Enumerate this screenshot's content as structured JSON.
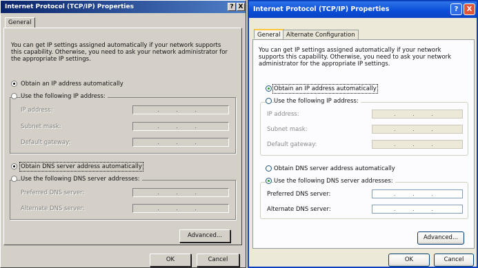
{
  "left": {
    "title": "Internet Protocol (TCP/IP) Properties",
    "help_btn": "?",
    "close_btn": "X",
    "tabs": [
      "General"
    ],
    "description": "You can get IP settings assigned automatically if your network supports this capability. Otherwise, you need to ask your network administrator for the appropriate IP settings.",
    "radio_auto_ip": "Obtain an IP address automatically",
    "radio_manual_ip": "Use the following IP address:",
    "ip_address_label": "IP address:",
    "subnet_label": "Subnet mask:",
    "gateway_label": "Default gateway:",
    "radio_auto_dns": "Obtain DNS server address automatically",
    "radio_manual_dns": "Use the following DNS server addresses:",
    "preferred_dns_label": "Preferred DNS server:",
    "alternate_dns_label": "Alternate DNS server:",
    "advanced_btn": "Advanced...",
    "ok_btn": "OK",
    "cancel_btn": "Cancel",
    "selected_ip_mode": "auto",
    "selected_dns_mode": "auto"
  },
  "right": {
    "title": "Internet Protocol (TCP/IP) Properties",
    "help_btn": "?",
    "close_btn": "X",
    "tabs": [
      "General",
      "Alternate Configuration"
    ],
    "description": "You can get IP settings assigned automatically if your network supports this capability. Otherwise, you need to ask your network administrator for the appropriate IP settings.",
    "radio_auto_ip": "Obtain an IP address automatically",
    "radio_manual_ip": "Use the following IP address:",
    "ip_address_label": "IP address:",
    "subnet_label": "Subnet mask:",
    "gateway_label": "Default gateway:",
    "radio_auto_dns": "Obtain DNS server address automatically",
    "radio_manual_dns": "Use the following DNS server addresses:",
    "preferred_dns_label": "Preferred DNS server:",
    "alternate_dns_label": "Alternate DNS server:",
    "advanced_btn": "Advanced...",
    "ok_btn": "OK",
    "cancel_btn": "Cancel",
    "selected_ip_mode": "auto",
    "selected_dns_mode": "manual"
  },
  "colors": {
    "classic_face": "#d4d0c8",
    "xp_face": "#ece9d8",
    "xp_titlebar": "#0b4fd8",
    "classic_titlebar": "#0a246a",
    "xp_close": "#e0563a"
  }
}
